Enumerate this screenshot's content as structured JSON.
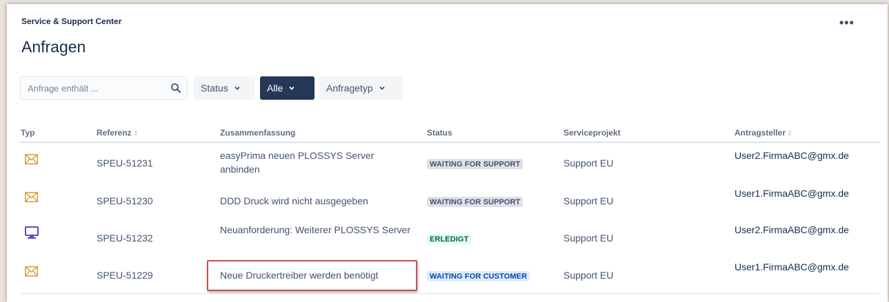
{
  "header": {
    "breadcrumb": "Service & Support Center",
    "title": "Anfragen",
    "more_label": "•••"
  },
  "filters": {
    "search_placeholder": "Anfrage enthält ...",
    "search_value": "",
    "status_label": "Status",
    "alle_label": "Alle",
    "type_label": "Anfragetyp",
    "alle_bg": "#253858"
  },
  "table": {
    "columns": {
      "typ": "Typ",
      "referenz": "Referenz",
      "zusammenfassung": "Zusammenfassung",
      "status": "Status",
      "serviceprojekt": "Serviceprojekt",
      "antragsteller": "Antragsteller"
    },
    "sort_glyph": "⇕",
    "rows": [
      {
        "type_icon": "envelope-icon",
        "reference": "SPEU-51231",
        "summary": "easyPrima neuen PLOSSYS Server anbinden",
        "status": "WAITING FOR SUPPORT",
        "project": "Support EU",
        "requester": "User2.FirmaABC@gmx.de"
      },
      {
        "type_icon": "envelope-icon",
        "reference": "SPEU-51230",
        "summary": "DDD Druck wird nicht ausgegeben",
        "status": "WAITING FOR SUPPORT",
        "project": "Support EU",
        "requester": "User1.FirmaABC@gmx.de"
      },
      {
        "type_icon": "monitor-icon",
        "reference": "SPEU-51232",
        "summary": "Neuanforderung: Weiterer PLOSSYS Server",
        "status": "ERLEDIGT",
        "project": "Support EU",
        "requester": "User2.FirmaABC@gmx.de"
      },
      {
        "type_icon": "envelope-icon",
        "reference": "SPEU-51229",
        "summary": "Neue Druckertreiber werden benötigt",
        "status": "WAITING FOR CUSTOMER",
        "project": "Support EU",
        "requester": "User1.FirmaABC@gmx.de"
      }
    ]
  },
  "colors": {
    "envelope": "#d99a3a",
    "monitor": "#5e4db2",
    "highlight_border": "#d0494b"
  }
}
